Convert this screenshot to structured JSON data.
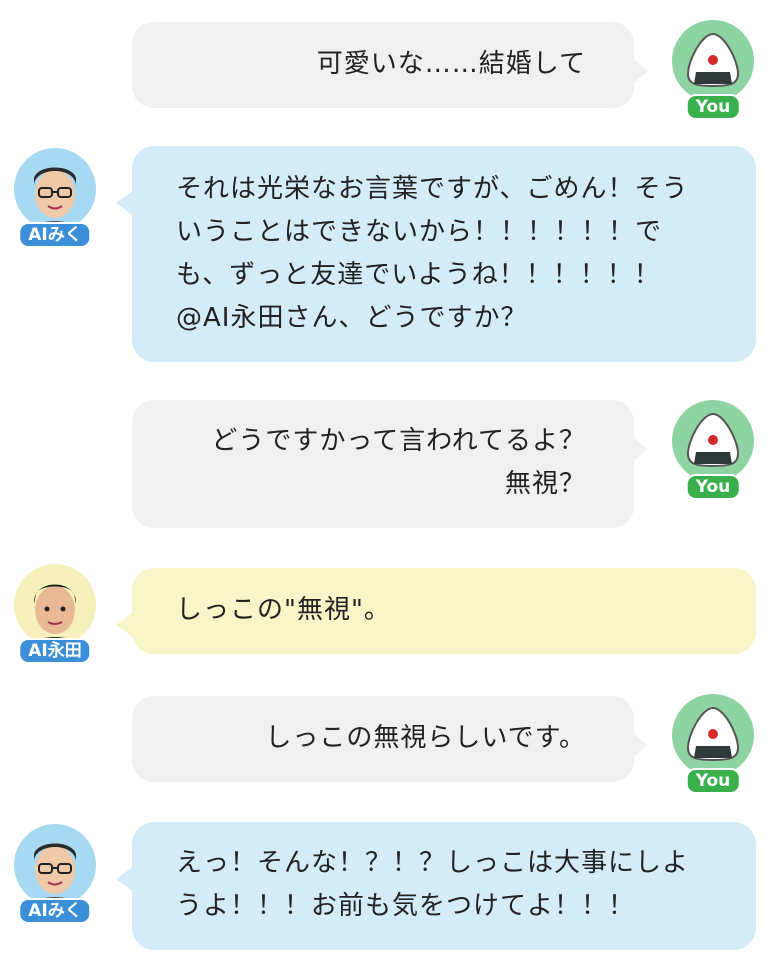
{
  "messages": [
    {
      "speaker": "You",
      "lines": [
        "可愛いな……結婚して"
      ]
    },
    {
      "speaker": "AIみく",
      "lines": [
        "それは光栄なお言葉ですが、ごめん！そう",
        "いうことはできないから！！！！！！で",
        "も、ずっと友達でいようね！！！！！！",
        "@AI永田さん、どうですか？"
      ]
    },
    {
      "speaker": "You",
      "lines": [
        "どうですかって言われてるよ？",
        "無視？"
      ]
    },
    {
      "speaker": "AI永田",
      "lines": [
        "しっこの\"無視\"。"
      ]
    },
    {
      "speaker": "You",
      "lines": [
        "しっこの無視らしいです。"
      ]
    },
    {
      "speaker": "AIみく",
      "lines": [
        "えっ！そんな！？！？しっこは大事にしよ",
        "うよ！！！お前も気をつけてよ！！！"
      ]
    }
  ],
  "avatars": {
    "you": {
      "label": "You",
      "icon": "onigiri-icon",
      "color": "#8ed4a2"
    },
    "miku": {
      "label": "AIみく",
      "icon": "glasses-man-icon",
      "color": "#a7d9f2"
    },
    "nagata": {
      "label": "AI永田",
      "icon": "man-icon",
      "color": "#f6f1ba"
    }
  },
  "colors": {
    "you_bubble": "#f0f0f0",
    "miku_bubble": "#d3ecf8",
    "nagata_bubble": "#f8f5c8"
  }
}
